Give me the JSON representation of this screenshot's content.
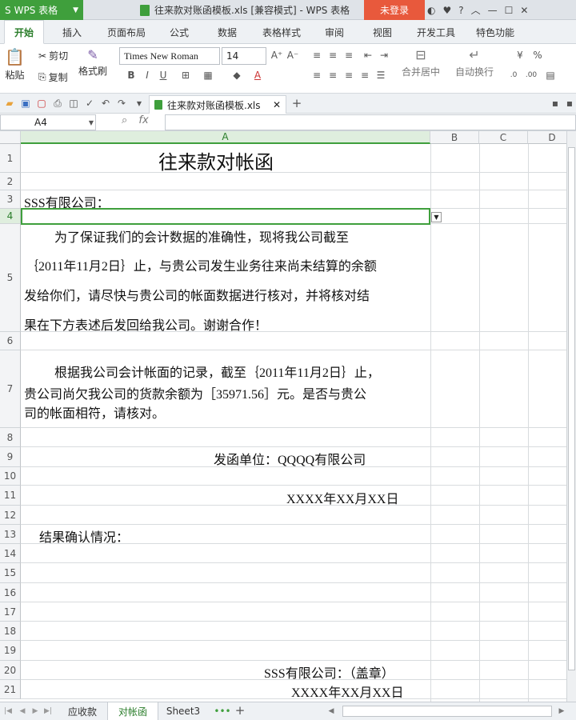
{
  "app": {
    "name": "WPS 表格",
    "doc_title": "往来款对账函模板.xls [兼容模式] - WPS 表格",
    "login": "未登录"
  },
  "ribbon_tabs": [
    "开始",
    "插入",
    "页面布局",
    "公式",
    "数据",
    "表格样式",
    "审阅",
    "视图",
    "开发工具",
    "特色功能"
  ],
  "ribbon": {
    "paste": "粘贴",
    "cut": "剪切",
    "copy": "复制",
    "format_painter": "格式刷",
    "font_name": "Times New Roman",
    "font_size": "14",
    "merge": "合并居中",
    "wrap": "自动换行"
  },
  "doc_tab": "往来款对账函模板.xls",
  "name_box": "A4",
  "fx_label": "fx",
  "columns": [
    "A",
    "B",
    "C",
    "D"
  ],
  "rows": [
    "1",
    "2",
    "3",
    "4",
    "5",
    "6",
    "7",
    "8",
    "9",
    "10",
    "11",
    "12",
    "13",
    "14",
    "15",
    "16",
    "17",
    "18",
    "19",
    "20",
    "21"
  ],
  "cells": {
    "title": "往来款对帐函",
    "r3": "SSS有限公司：",
    "r5_l1": "为了保证我们的会计数据的准确性，现将我公司截至",
    "r5_l2": "｛2011年11月2日｝止，与贵公司发生业务往来尚未结算的余额",
    "r5_l3": "发给你们，请尽快与贵公司的帐面数据进行核对，并将核对结",
    "r5_l4": "果在下方表述后发回给我公司。谢谢合作！",
    "r7_l1": "根据我公司会计帐面的记录，截至｛2011年11月2日｝止，",
    "r7_l2": "贵公司尚欠我公司的货款余额为［35971.56］元。是否与贵公",
    "r7_l3": "司的帐面相符，请核对。",
    "r9": "发函单位：QQQQ有限公司",
    "r11": "XXXX年XX月XX日",
    "r13": "结果确认情况：",
    "r20": "SSS有限公司：（盖章）",
    "r21": "XXXX年XX月XX日"
  },
  "sheets": [
    "应收款",
    "对帐函",
    "Sheet3"
  ]
}
